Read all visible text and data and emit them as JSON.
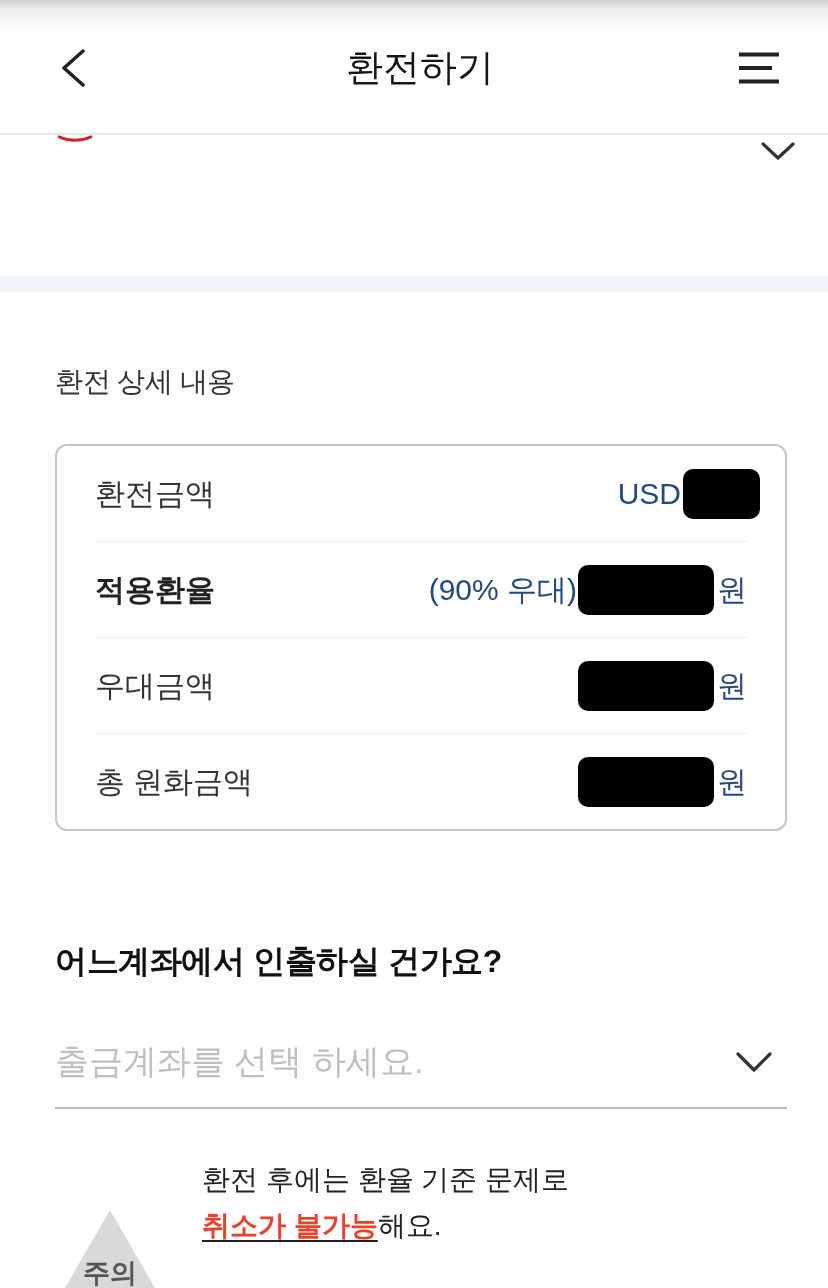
{
  "header": {
    "title": "환전하기"
  },
  "top_panel": {
    "expanded": false
  },
  "details": {
    "title": "환전 상세 내용",
    "rows": [
      {
        "label": "환전금액",
        "emphasis": false,
        "value": {
          "prefix": "USD",
          "redacted": true
        }
      },
      {
        "label": "적용환율",
        "emphasis": true,
        "value": {
          "prefix": "(90% 우대)",
          "redacted": true,
          "unit": "원"
        }
      },
      {
        "label": "우대금액",
        "emphasis": false,
        "value": {
          "redacted": true,
          "unit": "원"
        }
      },
      {
        "label": "총 원화금액",
        "emphasis": false,
        "value": {
          "redacted": true,
          "unit": "원"
        }
      }
    ]
  },
  "withdrawal": {
    "question": "어느계좌에서 인출하실 건가요?",
    "account_select": {
      "placeholder": "출금계좌를 선택 하세요."
    }
  },
  "notice": {
    "badge": "주의",
    "text": "환전 후에는 환율 기준 문제로 **취소가 불가능**해요."
  }
}
